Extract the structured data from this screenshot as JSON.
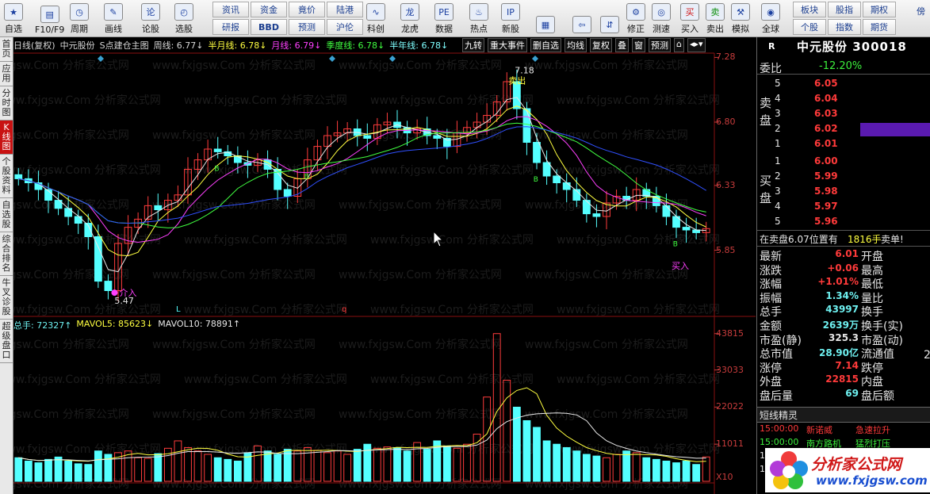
{
  "toolbar": {
    "left_buttons": [
      {
        "label": "自选",
        "icon": "star-icon"
      },
      {
        "label": "F10/F9",
        "icon": "f10-icon"
      },
      {
        "label": "周期",
        "icon": "clock-icon"
      },
      {
        "label": "画线",
        "icon": "pencil-icon"
      },
      {
        "label": "论股",
        "icon": "discuss-icon"
      },
      {
        "label": "选股",
        "icon": "chart-select-icon"
      }
    ],
    "grid_buttons": [
      "资讯",
      "资金",
      "竟价",
      "陆港",
      "研报",
      "BBD",
      "预测",
      "沪伦"
    ],
    "mid_buttons": [
      {
        "label": "科创",
        "icon": "kechuang-icon"
      },
      {
        "label": "龙虎",
        "icon": "dragon-icon"
      },
      {
        "label": "数据",
        "icon": "pe-icon"
      },
      {
        "label": "热点",
        "icon": "hot-icon"
      },
      {
        "label": "新股",
        "icon": "ipo-icon"
      }
    ],
    "right_buttons": [
      {
        "label": "",
        "icon": "window-icon"
      },
      {
        "label": "",
        "icon": "back-arrow-icon"
      },
      {
        "label": "",
        "icon": "up-down-icon"
      },
      {
        "label": "修正",
        "icon": "fix-icon"
      },
      {
        "label": "测速",
        "icon": "speed-icon"
      },
      {
        "label": "买入",
        "icon": "buy-icon",
        "glyph": "买"
      },
      {
        "label": "卖出",
        "icon": "sell-icon",
        "glyph": "卖"
      },
      {
        "label": "模拟",
        "icon": "hammer-icon"
      },
      {
        "label": "全球",
        "icon": "globe-icon"
      }
    ],
    "right_grid": [
      "板块",
      "股指",
      "期权",
      "个股",
      "指数",
      "期货"
    ],
    "cut_label": "傍"
  },
  "leftnav": [
    "首页",
    "应用",
    "分时图",
    "K线图",
    "个股资料",
    "自选股",
    "综合排名",
    "牛叉诊股",
    "超级盘口"
  ],
  "chart": {
    "header": {
      "period": "日线(复权)",
      "stock": "中元股份",
      "main": "S点建仓主图",
      "week": "周线: 6.77↓",
      "half_month": "半月线: 6.78↓",
      "month": "月线: 6.79↓",
      "season": "季度线: 6.78↓",
      "half_year": "半年线: 6.78↓"
    },
    "tabs": [
      "九转",
      "重大事件",
      "删自选",
      "均线",
      "复权",
      "叠",
      "窗",
      "预测",
      "⌂",
      "◂▸▾"
    ],
    "price_ticks": [
      "7.28",
      "6.80",
      "6.33",
      "5.85"
    ],
    "vol_ticks": [
      "43815",
      "33033",
      "22022",
      "11011",
      "X10"
    ],
    "annotations": {
      "high": "7.18",
      "low": "5.47",
      "buy_tag": "介入",
      "sell_tag": "卖出",
      "buy2_tag": "买入",
      "b": "B",
      "l": "L",
      "q": "q"
    },
    "vol_header": {
      "total": "总手: 72327↑",
      "ma5": "MAVOL5: 85623↓",
      "ma10": "MAVOL10: 78891↑"
    },
    "watermark": "www.fxjgsw.Com 分析家公式网"
  },
  "chart_data": {
    "type": "candlestick",
    "title": "",
    "ylim": [
      5.4,
      7.3
    ],
    "y_ticks": [
      7.28,
      6.8,
      6.33,
      5.85
    ],
    "volume_ticks": [
      43815,
      33033,
      22022,
      11011
    ],
    "volume_multiplier": "X10",
    "ma_values": {
      "week": 6.77,
      "half_month": 6.78,
      "month": 6.79,
      "season": 6.78,
      "half_year": 6.78
    },
    "high_mark": 7.18,
    "low_mark": 5.47,
    "closes": [
      6.38,
      6.35,
      6.3,
      6.22,
      6.16,
      6.1,
      6.05,
      5.95,
      5.62,
      5.55,
      5.9,
      6.02,
      6.08,
      6.18,
      6.15,
      6.22,
      6.26,
      6.45,
      6.52,
      6.6,
      6.58,
      6.55,
      6.5,
      6.48,
      6.52,
      6.45,
      6.3,
      6.25,
      6.38,
      6.52,
      6.62,
      6.7,
      6.72,
      6.75,
      6.7,
      6.68,
      6.78,
      6.8,
      6.76,
      6.72,
      6.75,
      6.7,
      6.68,
      6.62,
      6.72,
      6.76,
      6.8,
      6.85,
      6.95,
      7.1,
      6.9,
      6.65,
      6.5,
      6.4,
      6.35,
      6.3,
      6.22,
      6.12,
      6.1,
      6.2,
      6.25,
      6.22,
      6.3,
      6.25,
      6.18,
      6.1,
      6.02,
      6.0,
      5.98,
      6.01
    ],
    "volumes": [
      7000,
      6000,
      5500,
      6500,
      7200,
      6000,
      5200,
      5000,
      9000,
      8000,
      8500,
      9000,
      7000,
      6800,
      8200,
      9800,
      12000,
      10000,
      9000,
      8000,
      7000,
      6500,
      6000,
      8500,
      10500,
      9000,
      8000,
      9500,
      9000,
      10000,
      9200,
      8500,
      9000,
      8000,
      9500,
      11000,
      9800,
      10200,
      10000,
      9000,
      11500,
      9500,
      12000,
      10500,
      9800,
      11000,
      14000,
      25000,
      43815,
      30000,
      22000,
      18000,
      16000,
      12000,
      11000,
      10000,
      9000,
      8000,
      7500,
      7000,
      8000,
      9000,
      8500,
      7000,
      6500,
      6000,
      5500,
      6000,
      5000,
      7232
    ]
  },
  "panel": {
    "r_label": "R",
    "name": "中元股份 300018",
    "weibi_label": "委比",
    "weibi": "-12.20%",
    "sell_side": "卖盘",
    "buy_side": "买盘",
    "sell": [
      {
        "n": "5",
        "p": "6.05"
      },
      {
        "n": "4",
        "p": "6.04"
      },
      {
        "n": "3",
        "p": "6.03"
      },
      {
        "n": "2",
        "p": "6.02"
      },
      {
        "n": "1",
        "p": "6.01"
      }
    ],
    "buy": [
      {
        "n": "1",
        "p": "6.00"
      },
      {
        "n": "2",
        "p": "5.99"
      },
      {
        "n": "3",
        "p": "5.98"
      },
      {
        "n": "4",
        "p": "5.97"
      },
      {
        "n": "5",
        "p": "5.96"
      }
    ],
    "ticker": {
      "a": "在卖盘6.07位置有",
      "b": "1816手",
      "c": "卖单!"
    },
    "stats": [
      {
        "l": "最新",
        "v": "6.01",
        "r": "开盘",
        "vc": "red"
      },
      {
        "l": "涨跌",
        "v": "+0.06",
        "r": "最高",
        "vc": "red"
      },
      {
        "l": "涨幅",
        "v": "+1.01%",
        "r": "最低",
        "vc": "red"
      },
      {
        "l": "振幅",
        "v": "1.34%",
        "r": "量比",
        "vc": "cyan"
      },
      {
        "l": "总手",
        "v": "43997",
        "r": "换手",
        "vc": "cyan"
      },
      {
        "l": "金额",
        "v": "2639万",
        "r": "换手(实)",
        "vc": "cyan"
      },
      {
        "l": "市盈(静)",
        "v": "325.3",
        "r": "市盈(动)",
        "vc": "white"
      },
      {
        "l": "总市值",
        "v": "28.90亿",
        "r": "流通值",
        "vc": "cyan"
      },
      {
        "l": "涨停",
        "v": "7.14",
        "r": "跌停",
        "vc": "red"
      },
      {
        "l": "外盘",
        "v": "22815",
        "r": "内盘",
        "vc": "red"
      },
      {
        "l": "盘后量",
        "v": "69",
        "r": "盘后额",
        "vc": "cyan"
      }
    ],
    "stats_extra": "2",
    "drill_title": "短线精灵",
    "drill": [
      {
        "t": "15:00:00",
        "n": "新诺威",
        "a": "急速拉升",
        "c": "red"
      },
      {
        "t": "15:00:00",
        "n": "南方路机",
        "a": "猛烈打压",
        "c": "green"
      },
      {
        "t": "15:00:00",
        "n": "",
        "a": "",
        "c": "white"
      },
      {
        "t": "15",
        "n": "",
        "a": "",
        "c": "white"
      }
    ],
    "logo": {
      "l1": "分析家公式网",
      "l2": "www.fxjgsw.com"
    }
  }
}
